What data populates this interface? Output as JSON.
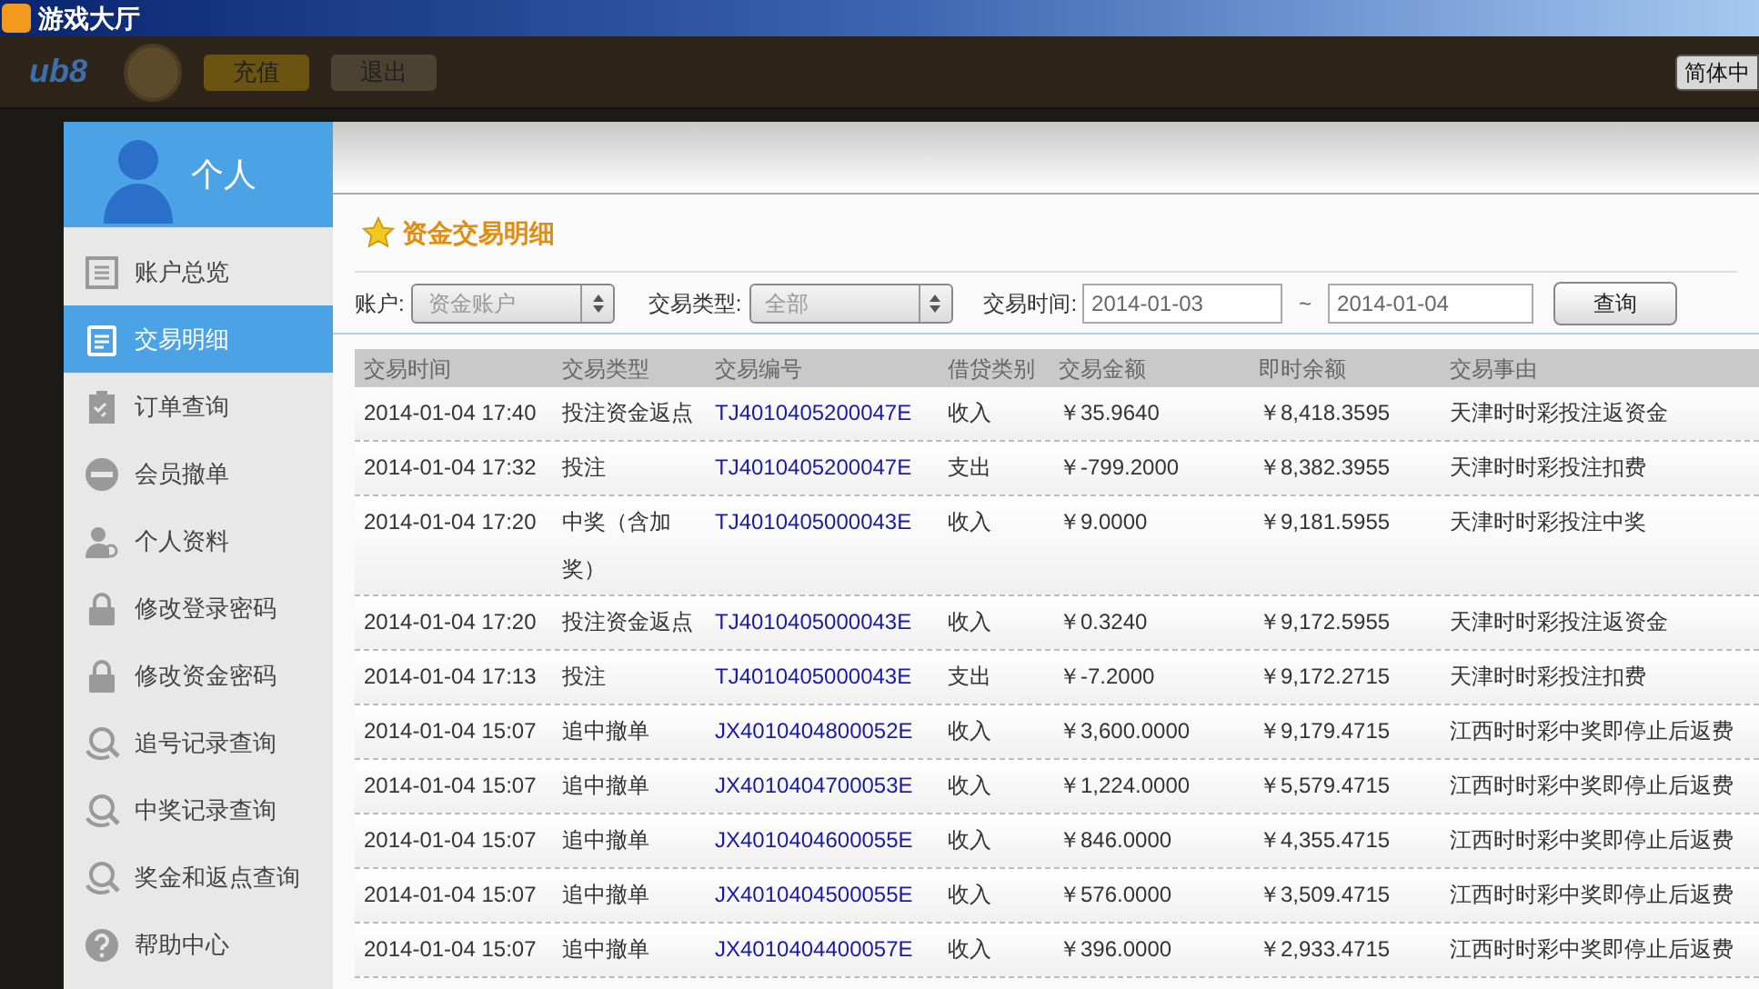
{
  "window": {
    "title": "游戏大厅"
  },
  "top_bar": {
    "logo": "ub8",
    "buttons": [
      "充值",
      "退出"
    ],
    "language": "简体中"
  },
  "sidebar": {
    "title": "个人",
    "items": [
      {
        "label": "账户总览",
        "kind": "list",
        "selected": false
      },
      {
        "label": "交易明细",
        "kind": "doc",
        "selected": true
      },
      {
        "label": "订单查询",
        "kind": "clipboard",
        "selected": false
      },
      {
        "label": "会员撤单",
        "kind": "minus",
        "selected": false
      },
      {
        "label": "个人资料",
        "kind": "person",
        "selected": false
      },
      {
        "label": "修改登录密码",
        "kind": "lock",
        "selected": false
      },
      {
        "label": "修改资金密码",
        "kind": "lock",
        "selected": false
      },
      {
        "label": "追号记录查询",
        "kind": "search",
        "selected": false
      },
      {
        "label": "中奖记录查询",
        "kind": "search",
        "selected": false
      },
      {
        "label": "奖金和返点查询",
        "kind": "search",
        "selected": false
      },
      {
        "label": "帮助中心",
        "kind": "help",
        "selected": false
      }
    ]
  },
  "content": {
    "title": "资金交易明细",
    "filters": {
      "account_label": "账户:",
      "account_value": "资金账户",
      "type_label": "交易类型:",
      "type_value": "全部",
      "time_label": "交易时间:",
      "date_from": "2014-01-03",
      "separator": "~",
      "date_to": "2014-01-04",
      "query_button": "查询"
    },
    "table": {
      "columns": [
        "交易时间",
        "交易类型",
        "交易编号",
        "借贷类别",
        "交易金额",
        "即时余额",
        "交易事由"
      ],
      "rows": [
        [
          "2014-01-04 17:40",
          "投注资金返点",
          "TJ4010405200047E",
          "收入",
          "￥35.9640",
          "￥8,418.3595",
          "天津时时彩投注返资金"
        ],
        [
          "2014-01-04 17:32",
          "投注",
          "TJ4010405200047E",
          "支出",
          "￥-799.2000",
          "￥8,382.3955",
          "天津时时彩投注扣费"
        ],
        [
          "2014-01-04 17:20",
          "中奖（含加奖）",
          "TJ4010405000043E",
          "收入",
          "￥9.0000",
          "￥9,181.5955",
          "天津时时彩投注中奖"
        ],
        [
          "2014-01-04 17:20",
          "投注资金返点",
          "TJ4010405000043E",
          "收入",
          "￥0.3240",
          "￥9,172.5955",
          "天津时时彩投注返资金"
        ],
        [
          "2014-01-04 17:13",
          "投注",
          "TJ4010405000043E",
          "支出",
          "￥-7.2000",
          "￥9,172.2715",
          "天津时时彩投注扣费"
        ],
        [
          "2014-01-04 15:07",
          "追中撤单",
          "JX4010404800052E",
          "收入",
          "￥3,600.0000",
          "￥9,179.4715",
          "江西时时彩中奖即停止后返费"
        ],
        [
          "2014-01-04 15:07",
          "追中撤单",
          "JX4010404700053E",
          "收入",
          "￥1,224.0000",
          "￥5,579.4715",
          "江西时时彩中奖即停止后返费"
        ],
        [
          "2014-01-04 15:07",
          "追中撤单",
          "JX4010404600055E",
          "收入",
          "￥846.0000",
          "￥4,355.4715",
          "江西时时彩中奖即停止后返费"
        ],
        [
          "2014-01-04 15:07",
          "追中撤单",
          "JX4010404500055E",
          "收入",
          "￥576.0000",
          "￥3,509.4715",
          "江西时时彩中奖即停止后返费"
        ],
        [
          "2014-01-04 15:07",
          "追中撤单",
          "JX4010404400057E",
          "收入",
          "￥396.0000",
          "￥2,933.4715",
          "江西时时彩中奖即停止后返费"
        ]
      ]
    }
  }
}
